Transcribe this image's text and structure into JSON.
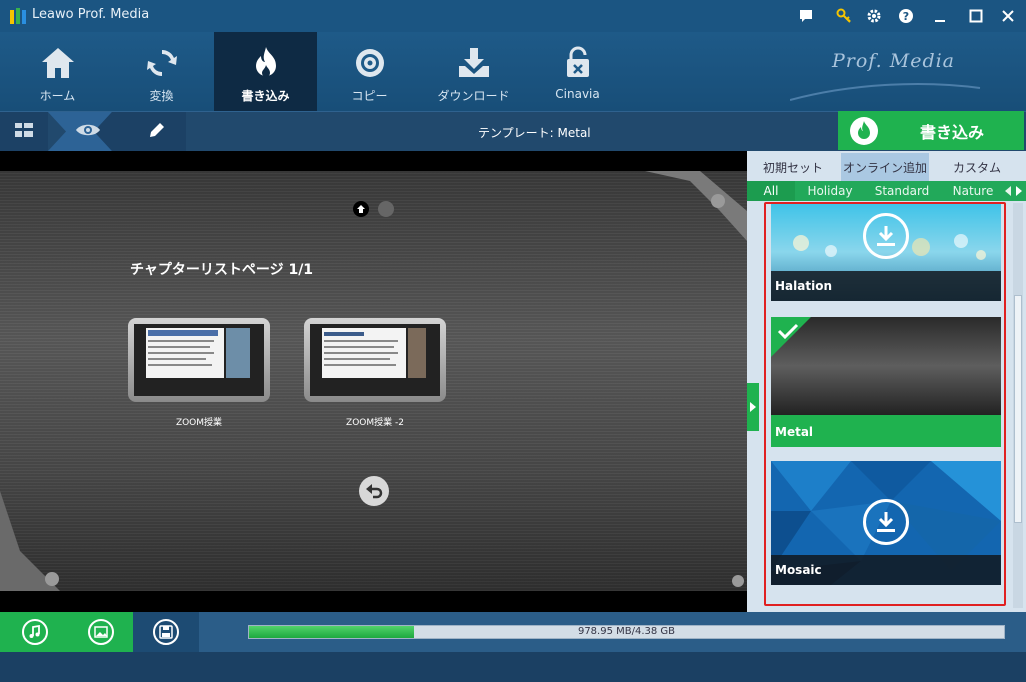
{
  "window": {
    "title": "Leawo Prof. Media"
  },
  "titlebar_icons": [
    "chat-icon",
    "key-icon",
    "gear-icon",
    "help-icon",
    "minimize-icon",
    "maximize-icon",
    "close-icon"
  ],
  "nav": {
    "items": [
      {
        "label": "ホーム",
        "icon": "home-icon",
        "active": false
      },
      {
        "label": "変換",
        "icon": "convert-icon",
        "active": false
      },
      {
        "label": "書き込み",
        "icon": "burn-icon",
        "active": true
      },
      {
        "label": "コピー",
        "icon": "copy-icon",
        "active": false
      },
      {
        "label": "ダウンロード",
        "icon": "download-icon",
        "active": false
      },
      {
        "label": "Cinavia",
        "icon": "cinavia-icon",
        "active": false
      }
    ],
    "brand": "Prof. Media"
  },
  "toolbar": {
    "template_label": "テンプレート: Metal",
    "burn_button": "書き込み"
  },
  "preview": {
    "chapter_title": "チャプターリストページ 1/1",
    "thumbs": [
      {
        "label": "ZOOM授業"
      },
      {
        "label": "ZOOM授業 -2"
      }
    ]
  },
  "panel": {
    "tabs": [
      {
        "label": "初期セット",
        "active": false
      },
      {
        "label": "オンライン追加",
        "active": true
      },
      {
        "label": "カスタム",
        "active": false
      }
    ],
    "categories": [
      {
        "label": "All",
        "active": true
      },
      {
        "label": "Holiday",
        "active": false
      },
      {
        "label": "Standard",
        "active": false
      },
      {
        "label": "Nature",
        "active": false
      }
    ],
    "templates": [
      {
        "name": "Halation",
        "selected": false,
        "downloadable": true
      },
      {
        "name": "Metal",
        "selected": true,
        "downloadable": false
      },
      {
        "name": "Mosaic",
        "selected": false,
        "downloadable": true
      }
    ]
  },
  "bottom": {
    "progress_text": "978.95 MB/4.38 GB",
    "progress_fraction": 0.2183
  },
  "colors": {
    "accent_green": "#1fb24f",
    "nav_blue": "#1b5582",
    "highlight_red": "#e02020"
  }
}
